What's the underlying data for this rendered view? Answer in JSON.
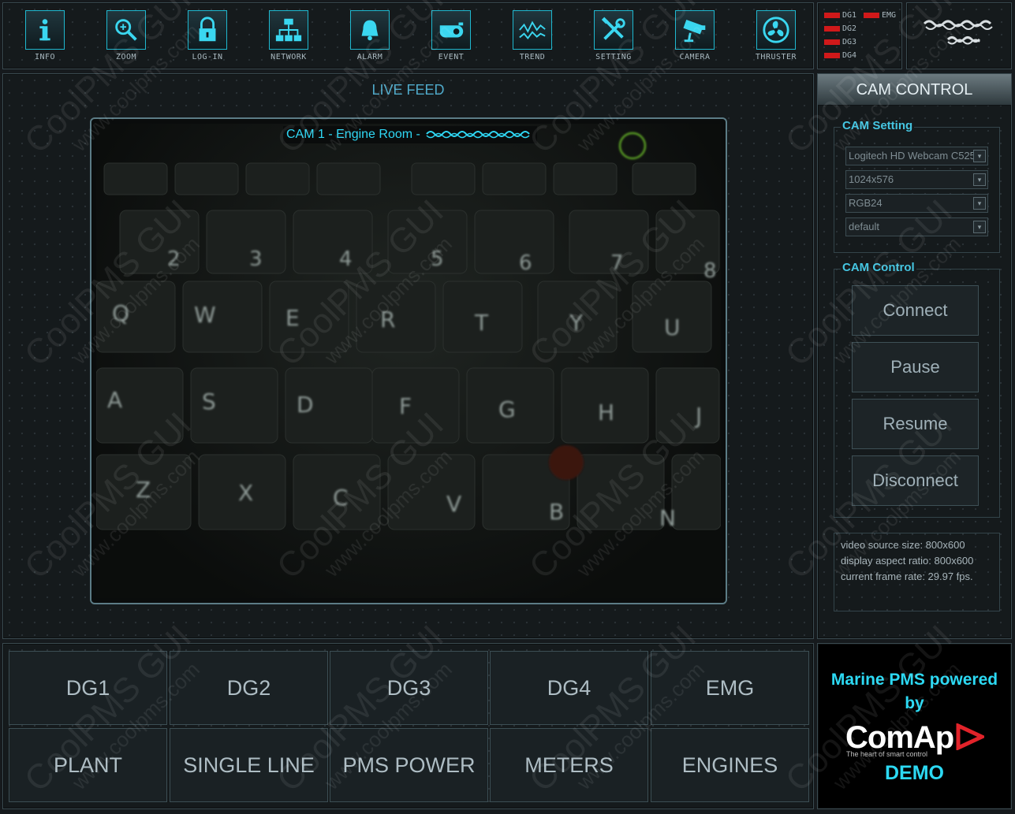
{
  "toolbar": {
    "items": [
      {
        "label": "INFO",
        "icon": "info-icon"
      },
      {
        "label": "ZOOM",
        "icon": "zoom-icon"
      },
      {
        "label": "LOG-IN",
        "icon": "lock-icon"
      },
      {
        "label": "NETWORK",
        "icon": "network-icon"
      },
      {
        "label": "ALARM",
        "icon": "bell-icon"
      },
      {
        "label": "EVENT",
        "icon": "event-icon"
      },
      {
        "label": "TREND",
        "icon": "trend-icon"
      },
      {
        "label": "SETTING",
        "icon": "tools-icon"
      },
      {
        "label": "CAMERA",
        "icon": "camera-icon"
      },
      {
        "label": "THRUSTER",
        "icon": "fan-icon"
      }
    ]
  },
  "status": {
    "leds": [
      {
        "label": "DG1",
        "color": "#d0191a"
      },
      {
        "label": "EMG",
        "color": "#d0191a"
      },
      {
        "label": "DG2",
        "color": "#d0191a"
      },
      {
        "label": "DG3",
        "color": "#d0191a"
      },
      {
        "label": "DG4",
        "color": "#d0191a"
      }
    ]
  },
  "live_feed": {
    "title": "LIVE FEED",
    "cam_title": "CAM 1 - Engine Room -"
  },
  "cam_control": {
    "header": "CAM CONTROL",
    "setting_title": "CAM Setting",
    "selects": [
      "Logitech HD Webcam C525",
      "1024x576",
      "RGB24",
      "default"
    ],
    "control_title": "CAM Control",
    "buttons": [
      "Connect",
      "Pause",
      "Resume",
      "Disconnect"
    ],
    "info": [
      "video source size: 800x600",
      "display aspect ratio: 800x600",
      "current frame rate: 29.97 fps."
    ]
  },
  "nav": {
    "row1": [
      "DG1",
      "DG2",
      "DG3",
      "DG4",
      "EMG"
    ],
    "row2": [
      "PLANT",
      "SINGLE LINE",
      "PMS POWER",
      "METERS",
      "ENGINES"
    ]
  },
  "powered": {
    "line1": "Marine PMS powered",
    "line2": "by",
    "brand": "ComAp",
    "tagline": "The heart of smart control",
    "demo": "DEMO"
  },
  "watermark": {
    "name": "CoolPMS GUI",
    "url": "www.coolpms.com"
  },
  "colors": {
    "accent": "#2cd9f3",
    "led_red": "#d0191a",
    "panel_bg": "#151a1c"
  }
}
